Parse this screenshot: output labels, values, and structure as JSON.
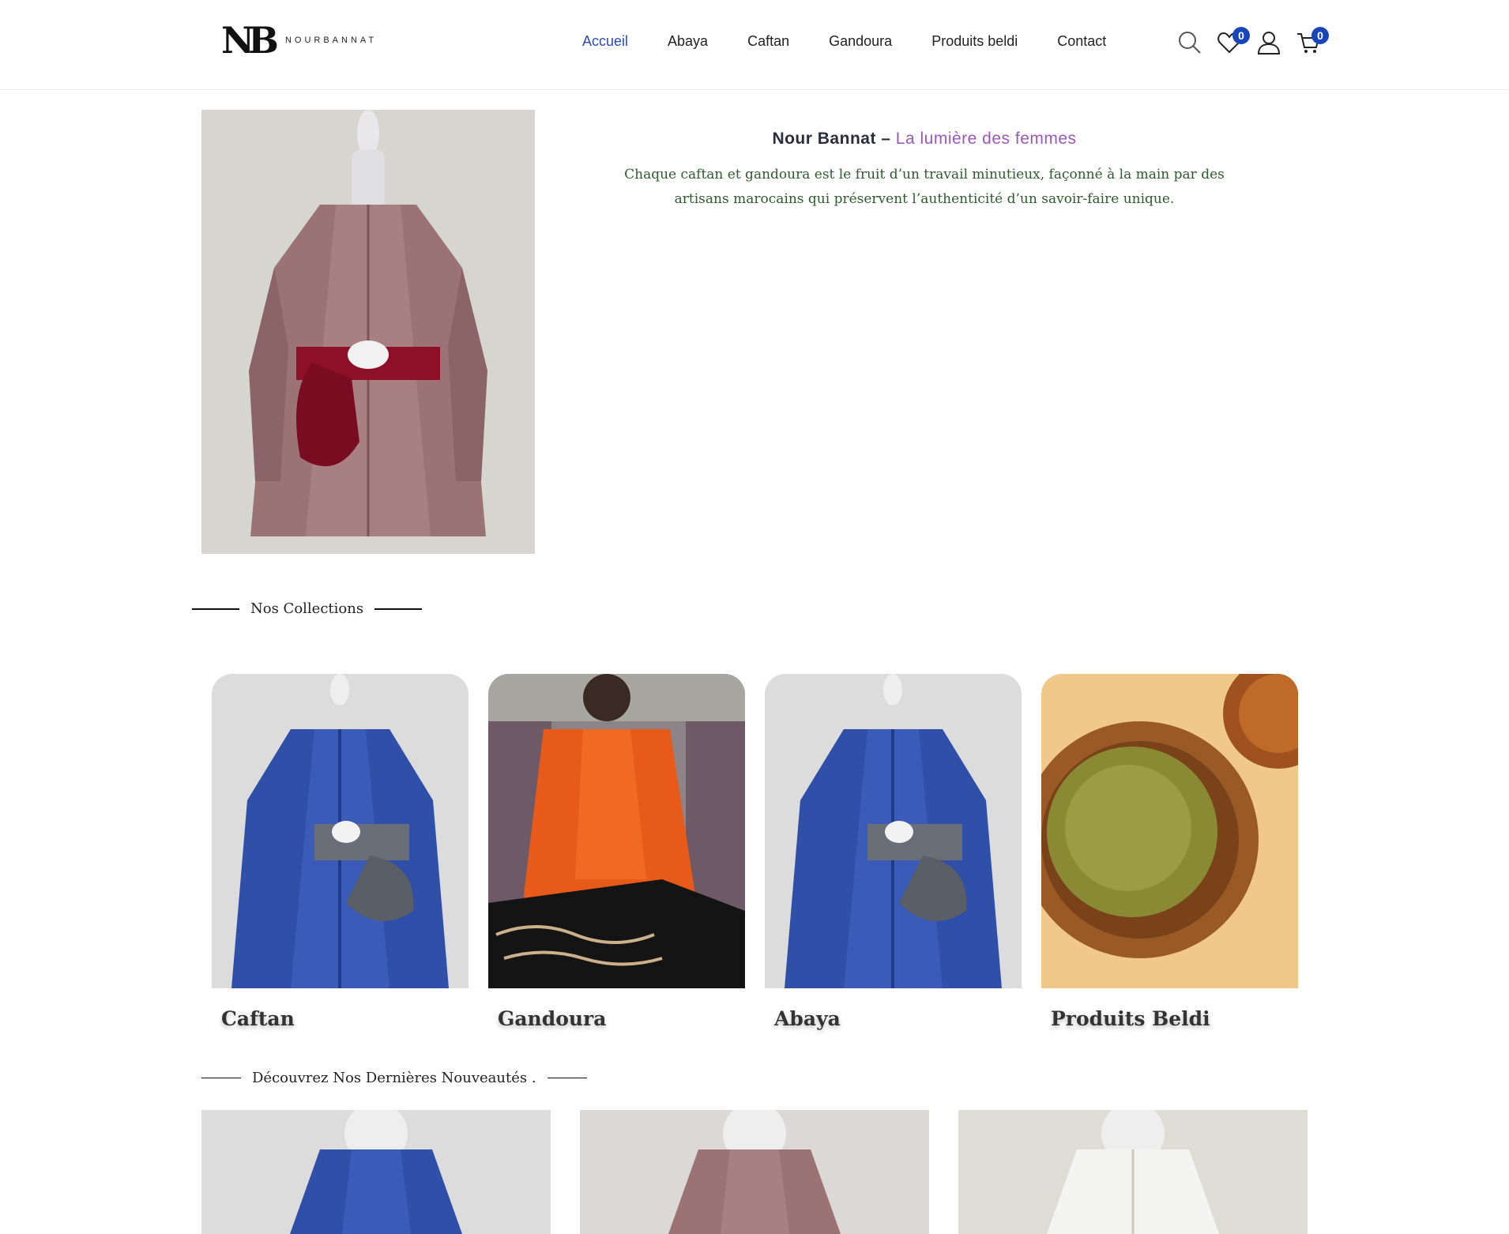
{
  "header": {
    "logo_mark": "NB",
    "logo_text": "NOURBANNAT",
    "nav": [
      "Accueil",
      "Abaya",
      "Caftan",
      "Gandoura",
      "Produits beldi",
      "Contact"
    ],
    "icons": {
      "search": "search-icon",
      "wishlist": "heart-icon",
      "account": "user-icon",
      "cart": "cart-icon"
    },
    "wishlist_count": "0",
    "cart_count": "0",
    "accent_color": "#2c4ab8"
  },
  "hero": {
    "title_main": "Nour Bannat –",
    "title_accent": "La lumière des femmes",
    "description": "Chaque caftan et gandoura est le fruit d’un travail minutieux, façonné à la main par des artisans marocains qui préservent l’authenticité d’un savoir-faire unique."
  },
  "collections": {
    "heading": "Nos Collections",
    "items": [
      {
        "label": "Caftan"
      },
      {
        "label": "Gandoura"
      },
      {
        "label": "Abaya"
      },
      {
        "label": "Produits Beldi"
      }
    ]
  },
  "new_arrivals": {
    "heading": "Découvrez Nos Dernières Nouveautés ."
  }
}
